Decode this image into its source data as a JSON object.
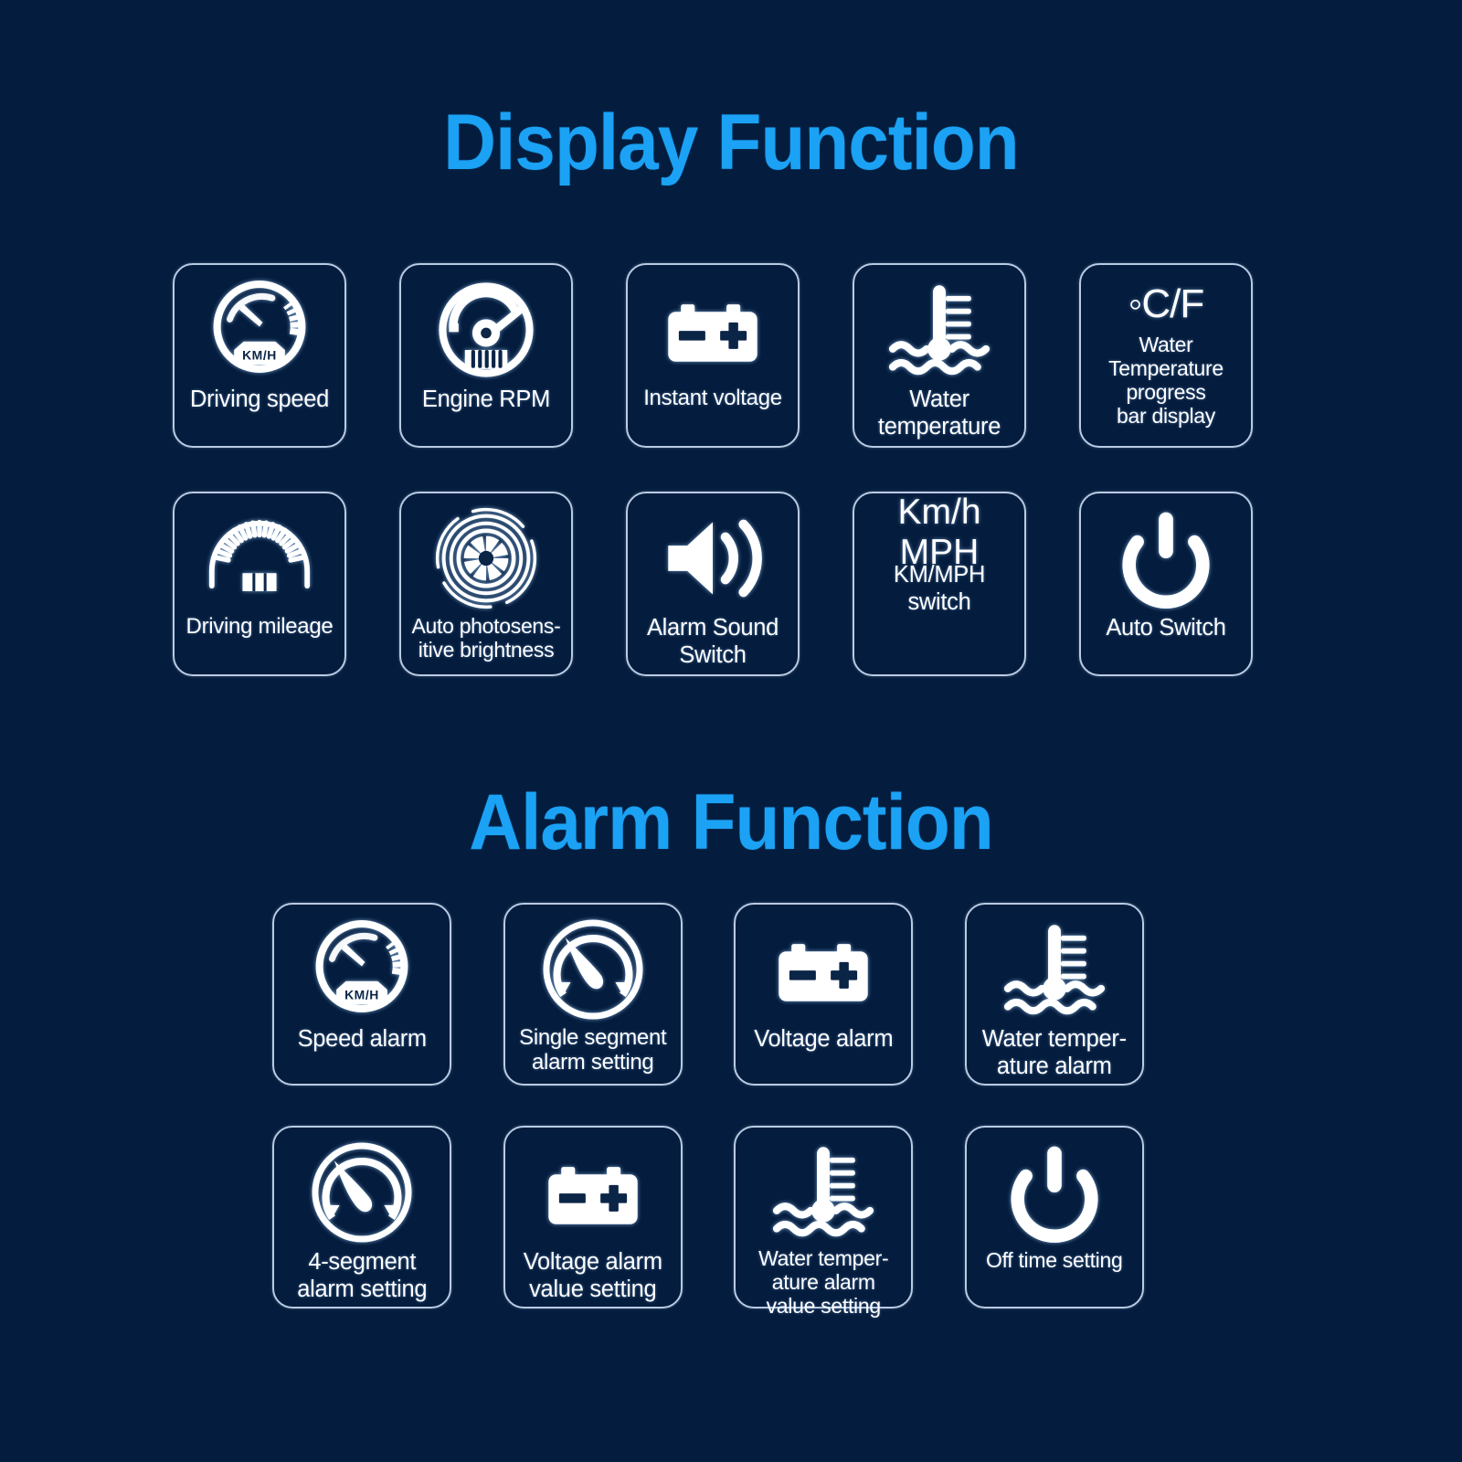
{
  "background_color": "#041c3d",
  "accent_color": "#1ba2f5",
  "tile_border_color": "#b9cbe4",
  "sections": [
    {
      "title": "Display Function",
      "tiles": [
        {
          "icon": "speedometer-icon",
          "icon_text": "KM/H",
          "label": "Driving speed"
        },
        {
          "icon": "tachometer-icon",
          "label": "Engine RPM"
        },
        {
          "icon": "battery-icon",
          "label": "Instant voltage"
        },
        {
          "icon": "water-temperature-icon",
          "label": "Water\ntemperature"
        },
        {
          "icon": "celsius-fahrenheit-text-icon",
          "icon_text": "◦C/F",
          "label": "Water\nTemperature\nprogress\nbar display"
        },
        {
          "icon": "odometer-icon",
          "label": "Driving mileage"
        },
        {
          "icon": "aperture-icon",
          "label": "Auto photosens-\nitive brightness"
        },
        {
          "icon": "speaker-icon",
          "label": "Alarm Sound\nSwitch"
        },
        {
          "icon": "km-mph-text-icon",
          "icon_text": "Km/h\nMPH",
          "label": "KM/MPH\nswitch"
        },
        {
          "icon": "power-icon",
          "label": "Auto Switch"
        }
      ]
    },
    {
      "title": "Alarm Function",
      "tiles": [
        {
          "icon": "speedometer-icon",
          "icon_text": "KM/H",
          "label": "Speed alarm"
        },
        {
          "icon": "needle-gauge-icon",
          "label": "Single segment\nalarm setting"
        },
        {
          "icon": "battery-icon",
          "label": "Voltage alarm"
        },
        {
          "icon": "water-temperature-icon",
          "label": "Water temper-\nature alarm"
        },
        {
          "icon": "needle-gauge-icon",
          "label": "4-segment\nalarm setting"
        },
        {
          "icon": "battery-icon",
          "label": "Voltage alarm\nvalue setting"
        },
        {
          "icon": "water-temperature-icon",
          "label": "Water temper-\nature alarm\nvalue setting"
        },
        {
          "icon": "power-icon",
          "label": "Off time setting"
        }
      ]
    }
  ]
}
